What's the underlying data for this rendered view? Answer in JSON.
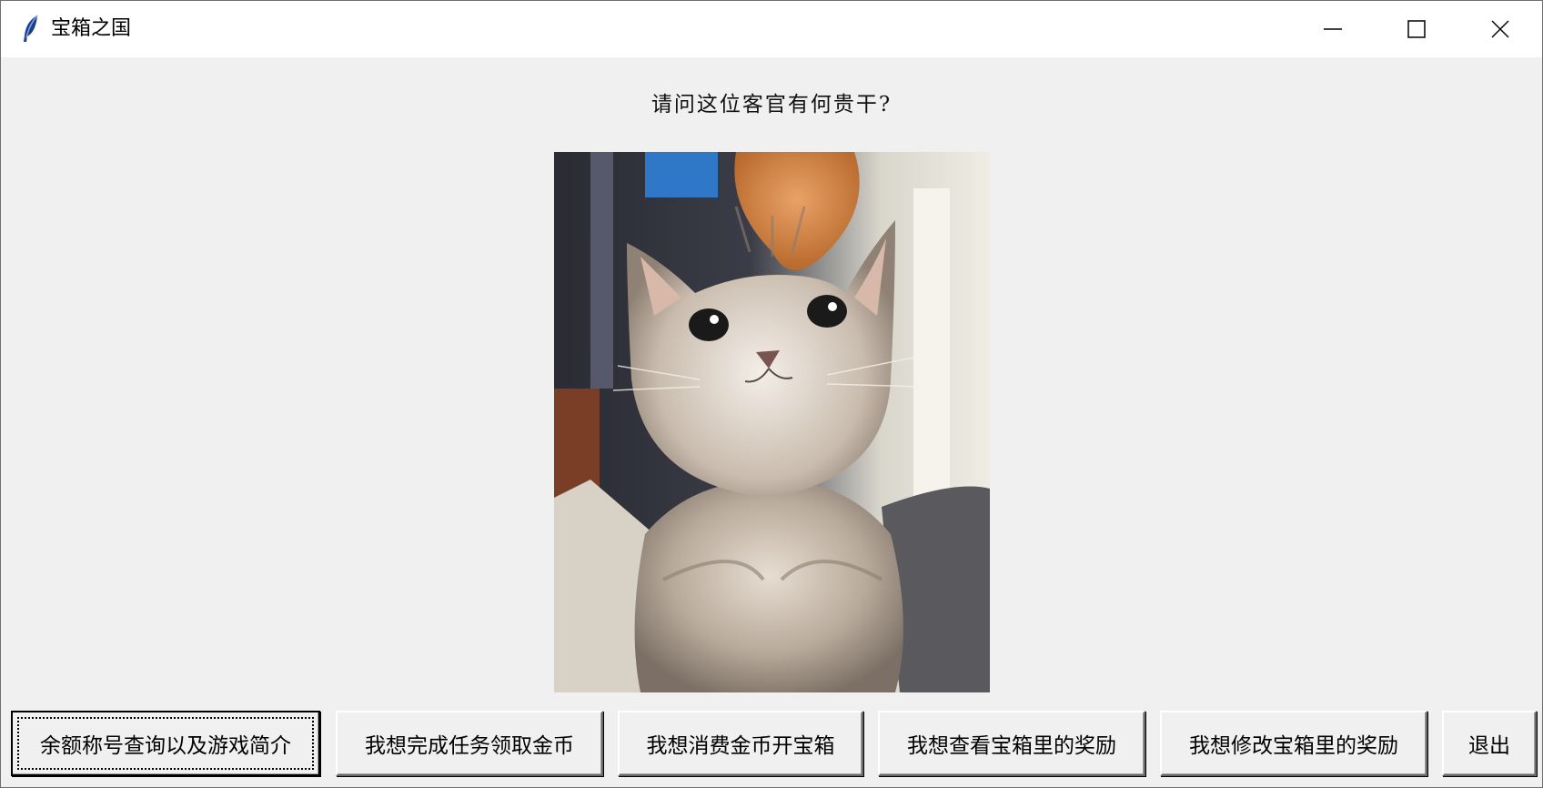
{
  "window": {
    "title": "宝箱之国",
    "controls": {
      "minimize": "minimize-icon",
      "maximize": "maximize-icon",
      "close": "close-icon"
    }
  },
  "main": {
    "prompt": "请问这位客官有何贵干?",
    "image": "cat-photo"
  },
  "buttons": [
    {
      "label": "余额称号查询以及游戏简介"
    },
    {
      "label": "我想完成任务领取金币"
    },
    {
      "label": "我想消费金币开宝箱"
    },
    {
      "label": "我想查看宝箱里的奖励"
    },
    {
      "label": "我想修改宝箱里的奖励"
    },
    {
      "label": "退出"
    }
  ],
  "colors": {
    "window_bg": "#f0f0f0",
    "titlebar_bg": "#ffffff"
  }
}
